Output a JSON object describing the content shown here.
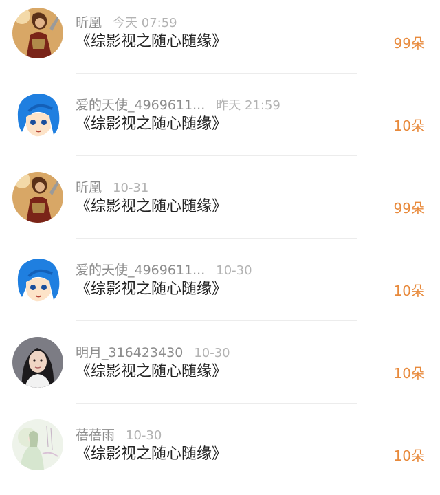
{
  "entries": [
    {
      "username": "昕凰",
      "time": "今天 07:59",
      "book": "《综影视之随心随缘》",
      "amount": "99朵",
      "avatar": "warrior-avatar"
    },
    {
      "username": "爱的天使_4969611...",
      "time": "昨天 21:59",
      "book": "《综影视之随心随缘》",
      "amount": "10朵",
      "avatar": "blue-hair-anime-avatar"
    },
    {
      "username": "昕凰",
      "time": "10-31",
      "book": "《综影视之随心随缘》",
      "amount": "99朵",
      "avatar": "warrior-avatar"
    },
    {
      "username": "爱的天使_4969611...",
      "time": "10-30",
      "book": "《综影视之随心随缘》",
      "amount": "10朵",
      "avatar": "blue-hair-anime-avatar"
    },
    {
      "username": "明月_316423430",
      "time": "10-30",
      "book": "《综影视之随心随缘》",
      "amount": "10朵",
      "avatar": "girl-photo-avatar"
    },
    {
      "username": "蓓蓓雨",
      "time": "10-30",
      "book": "《综影视之随心随缘》",
      "amount": "10朵",
      "avatar": "pastel-illustration-avatar"
    }
  ],
  "colors": {
    "amount": "#e88a3c",
    "username": "#8c8c8c",
    "time": "#b3b3b3",
    "book": "#222222",
    "divider": "#ececec"
  }
}
